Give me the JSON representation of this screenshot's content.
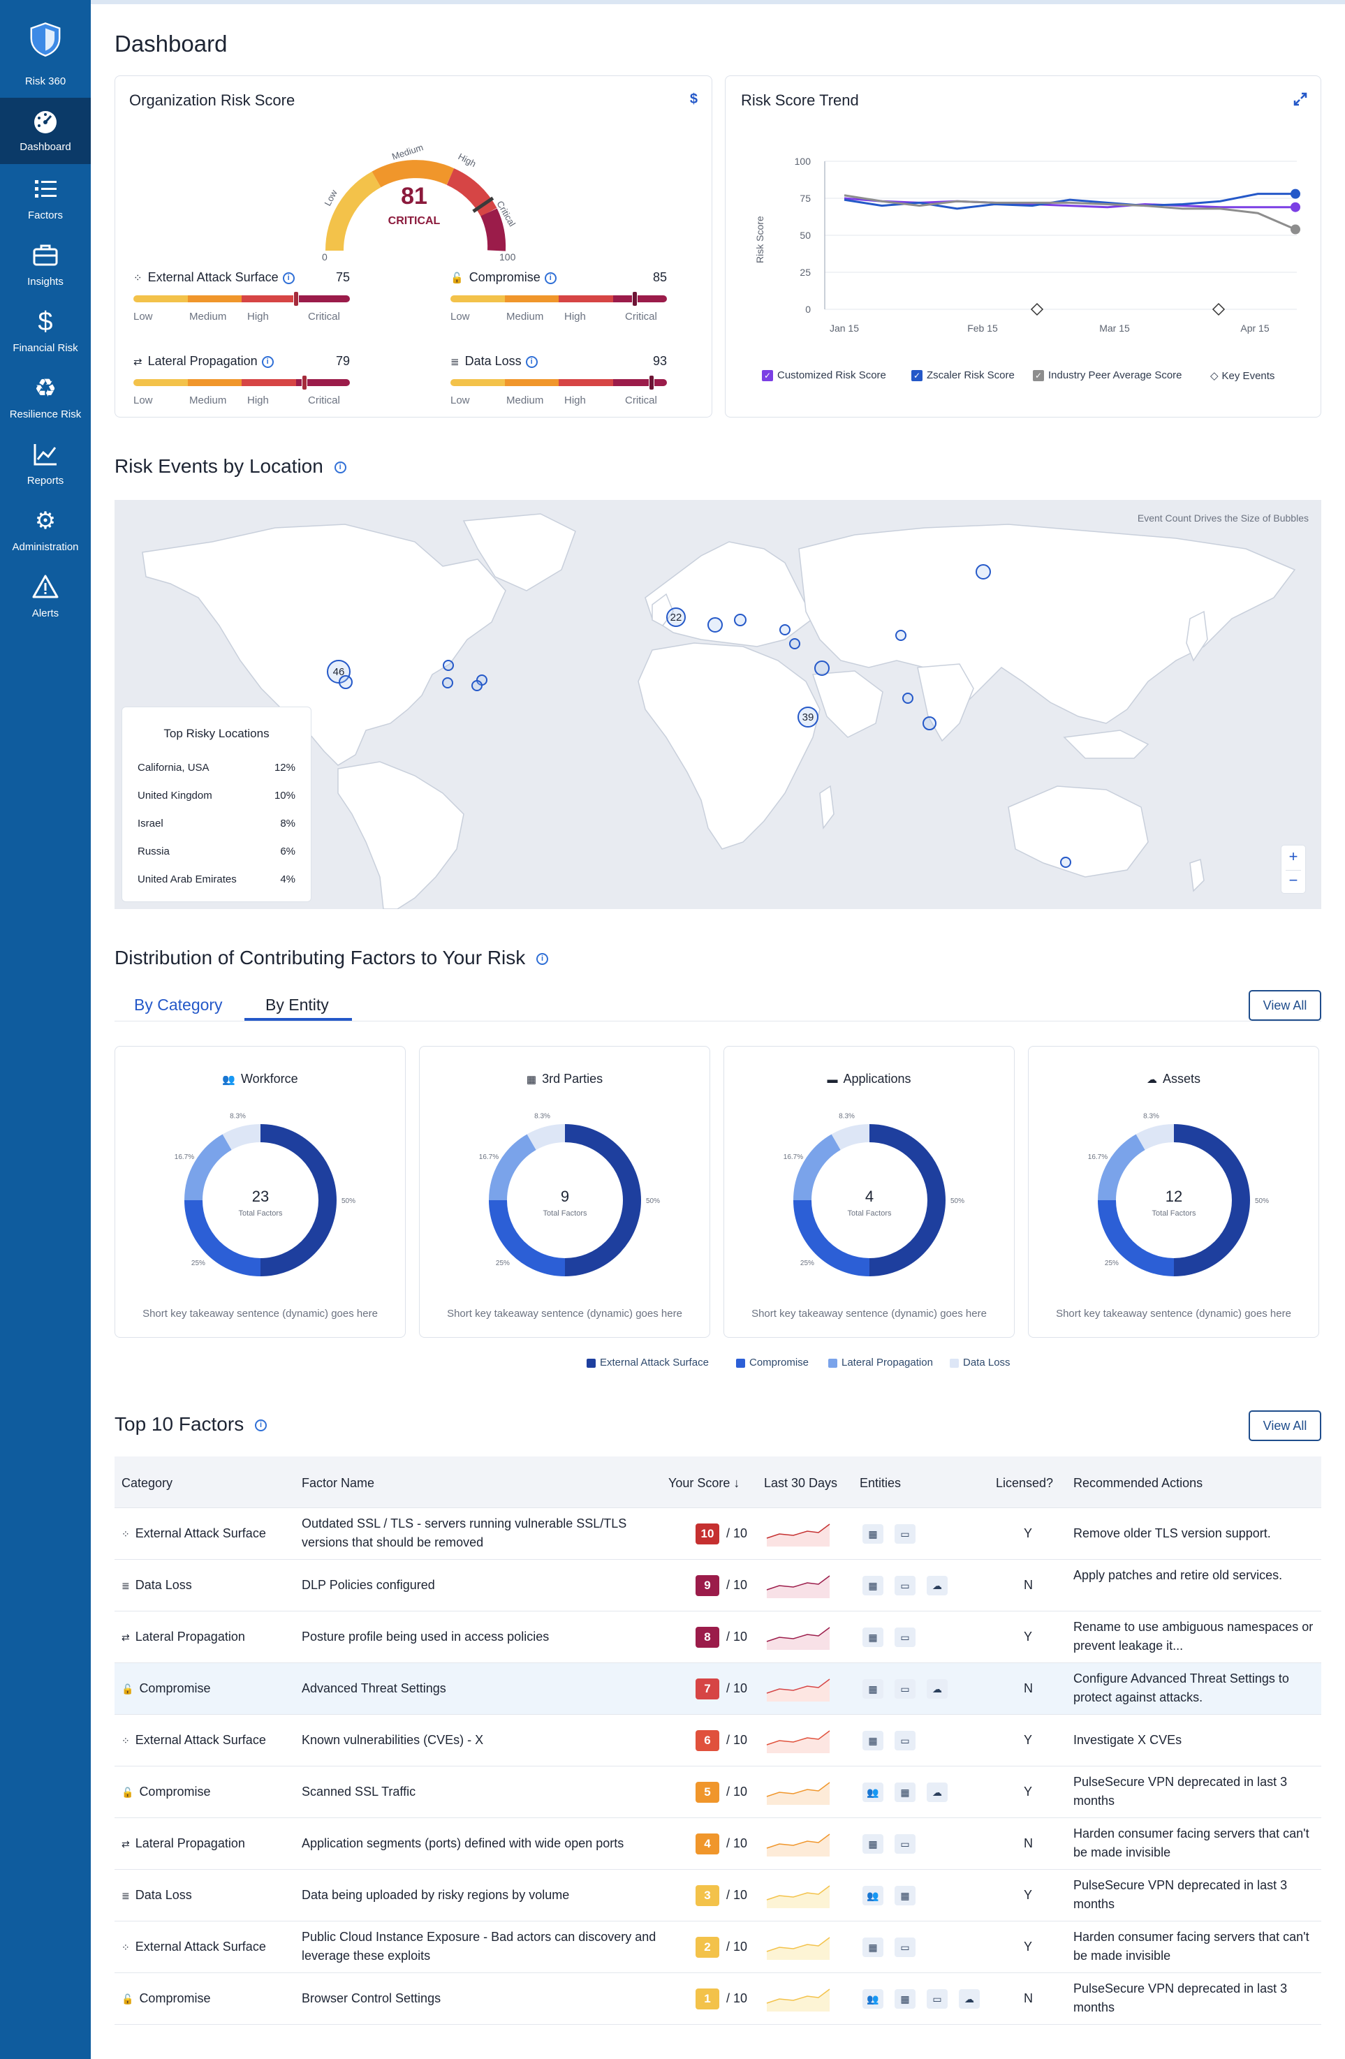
{
  "sidebar": {
    "logo_label": "Risk 360",
    "items": [
      {
        "label": "Dashboard",
        "icon": "gauge-icon"
      },
      {
        "label": "Factors",
        "icon": "list-icon"
      },
      {
        "label": "Insights",
        "icon": "briefcase-icon"
      },
      {
        "label": "Financial Risk",
        "icon": "dollar-icon"
      },
      {
        "label": "Resilience Risk",
        "icon": "recycle-icon"
      },
      {
        "label": "Reports",
        "icon": "chart-line-icon"
      },
      {
        "label": "Administration",
        "icon": "gears-icon"
      },
      {
        "label": "Alerts",
        "icon": "warning-icon"
      }
    ]
  },
  "page": {
    "title": "Dashboard"
  },
  "risk_score": {
    "title": "Organization Risk Score",
    "currency_symbol": "$",
    "score": "81",
    "level": "CRITICAL",
    "score_value": 81,
    "gauge_min": "0",
    "gauge_max": "100",
    "gauge_labels": {
      "low": "Low",
      "medium": "Medium",
      "high": "High",
      "critical": "Critical"
    },
    "metrics": [
      {
        "name": "External Attack Surface",
        "value": "75",
        "score": 75,
        "icon": "network-icon"
      },
      {
        "name": "Compromise",
        "value": "85",
        "score": 85,
        "icon": "unlock-icon"
      },
      {
        "name": "Lateral Propagation",
        "value": "79",
        "score": 79,
        "icon": "arrows-icon"
      },
      {
        "name": "Data Loss",
        "value": "93",
        "score": 93,
        "icon": "database-icon"
      }
    ],
    "scale_labels": [
      "Low",
      "Medium",
      "High",
      "Critical"
    ]
  },
  "trend": {
    "title": "Risk Score Trend",
    "chart_data": {
      "type": "line",
      "ylabel": "Risk Score",
      "ylim": [
        0,
        100
      ],
      "yticks": [
        "100",
        "75",
        "50",
        "25",
        "0"
      ],
      "xticks": [
        "Jan 15",
        "Feb 15",
        "Mar 15",
        "Apr 15"
      ],
      "series": [
        {
          "name": "Customized Risk Score",
          "color": "#7b3fe4",
          "values": [
            75,
            73,
            72,
            73,
            72,
            71,
            70,
            69,
            71,
            70,
            69,
            69,
            69
          ]
        },
        {
          "name": "Zscaler Risk Score",
          "color": "#2458c8",
          "values": [
            74,
            70,
            72,
            68,
            71,
            70,
            74,
            72,
            70,
            71,
            73,
            78,
            78
          ]
        },
        {
          "name": "Industry Peer Average Score",
          "color": "#8d8d8d",
          "values": [
            77,
            73,
            70,
            73,
            72,
            72,
            72,
            71,
            70,
            68,
            68,
            65,
            54
          ]
        }
      ],
      "key_events": [
        "Feb 25",
        "Apr 10"
      ],
      "legend": [
        "Customized Risk Score",
        "Zscaler Risk Score",
        "Industry Peer Average Score",
        "Key Events"
      ]
    }
  },
  "map": {
    "title": "Risk Events by Location",
    "note": "Event Count Drives the Size of Bubbles",
    "bubble_labels": [
      "22",
      "46",
      "39"
    ],
    "top_locations_title": "Top Risky Locations",
    "top_locations": [
      {
        "name": "California, USA",
        "pct": "12%"
      },
      {
        "name": "United Kingdom",
        "pct": "10%"
      },
      {
        "name": "Israel",
        "pct": "8%"
      },
      {
        "name": "Russia",
        "pct": "6%"
      },
      {
        "name": "United Arab Emirates",
        "pct": "4%"
      }
    ],
    "zoom_in": "+",
    "zoom_out": "−"
  },
  "distribution": {
    "title": "Distribution of Contributing Factors to Your Risk",
    "tabs": [
      "By Category",
      "By Entity"
    ],
    "active_tab": "By Entity",
    "view_all": "View All",
    "cards": [
      {
        "title": "Workforce",
        "icon": "users-icon",
        "total": "23",
        "total_label": "Total Factors",
        "footer": "Short key takeaway sentence (dynamic) goes here"
      },
      {
        "title": "3rd Parties",
        "icon": "grid-icon",
        "total": "9",
        "total_label": "Total Factors",
        "footer": "Short key takeaway sentence (dynamic) goes here"
      },
      {
        "title": "Applications",
        "icon": "window-icon",
        "total": "4",
        "total_label": "Total Factors",
        "footer": "Short key takeaway sentence (dynamic) goes here"
      },
      {
        "title": "Assets",
        "icon": "cloud-icon",
        "total": "12",
        "total_label": "Total Factors",
        "footer": "Short key takeaway sentence (dynamic) goes here"
      }
    ],
    "chart_data": {
      "type": "pie",
      "categories": [
        "External Attack Surface",
        "Compromise",
        "Lateral Propagation",
        "Data Loss"
      ],
      "values": [
        50,
        25,
        16.7,
        8.3
      ],
      "labels": [
        "50%",
        "25%",
        "16.7%",
        "8.3%"
      ],
      "colors": [
        "#1e3f9e",
        "#2c5fd6",
        "#7aa3ea",
        "#dde6f6"
      ]
    },
    "legend": [
      "External Attack Surface",
      "Compromise",
      "Lateral Propagation",
      "Data Loss"
    ]
  },
  "factors": {
    "title": "Top 10 Factors",
    "view_all": "View All",
    "headers": [
      "Category",
      "Factor Name",
      "Your Score",
      "Last 30 Days",
      "Entities",
      "Licensed?",
      "Recommended Actions"
    ],
    "sort_arrow": "↓",
    "out_of": "/ 10",
    "rows": [
      {
        "category": "External Attack Surface",
        "cat_icon": "network-icon",
        "name": "Outdated SSL / TLS - servers running vulnerable SSL/TLS versions that should be removed",
        "score": "10",
        "color": "#c53030",
        "entities": [
          "grid-icon",
          "window-icon"
        ],
        "licensed": "Y",
        "action": "Remove older TLS version support."
      },
      {
        "category": "Data Loss",
        "cat_icon": "database-icon",
        "name": "DLP Policies configured",
        "score": "9",
        "color": "#9b1c4a",
        "entities": [
          "grid-icon",
          "window-icon",
          "cloud-icon"
        ],
        "licensed": "N",
        "action": "Apply patches and retire old services."
      },
      {
        "category": "Lateral Propagation",
        "cat_icon": "arrows-icon",
        "name": "Posture profile being used in access policies",
        "score": "8",
        "color": "#9b1c4a",
        "entities": [
          "grid-icon",
          "window-icon"
        ],
        "licensed": "Y",
        "action": "Rename to use ambiguous namespaces or prevent leakage it..."
      },
      {
        "category": "Compromise",
        "cat_icon": "unlock-icon",
        "name": "Advanced Threat Settings",
        "score": "7",
        "color": "#d64545",
        "entities": [
          "grid-icon",
          "window-icon",
          "cloud-icon"
        ],
        "licensed": "N",
        "action": "Configure Advanced Threat Settings to protect against attacks."
      },
      {
        "category": "External Attack Surface",
        "cat_icon": "network-icon",
        "name": "Known vulnerabilities (CVEs) - X",
        "score": "6",
        "color": "#e0513c",
        "entities": [
          "grid-icon",
          "window-icon"
        ],
        "licensed": "Y",
        "action": "Investigate X CVEs"
      },
      {
        "category": "Compromise",
        "cat_icon": "unlock-icon",
        "name": "Scanned SSL Traffic",
        "score": "5",
        "color": "#f0962b",
        "entities": [
          "users-icon",
          "grid-icon",
          "cloud-icon"
        ],
        "licensed": "Y",
        "action": "PulseSecure VPN deprecated in last 3 months"
      },
      {
        "category": "Lateral Propagation",
        "cat_icon": "arrows-icon",
        "name": "Application segments (ports) defined with wide open ports",
        "score": "4",
        "color": "#f0962b",
        "entities": [
          "grid-icon",
          "window-icon"
        ],
        "licensed": "N",
        "action": "Harden consumer facing servers that can't be made invisible"
      },
      {
        "category": "Data Loss",
        "cat_icon": "database-icon",
        "name": "Data being uploaded by risky regions by volume",
        "score": "3",
        "color": "#f3c24a",
        "entities": [
          "users-icon",
          "grid-icon"
        ],
        "licensed": "Y",
        "action": "PulseSecure VPN deprecated in last 3 months"
      },
      {
        "category": "External Attack Surface",
        "cat_icon": "network-icon",
        "name": "Public Cloud Instance Exposure - Bad actors can discovery and leverage these exploits",
        "score": "2",
        "color": "#f3c24a",
        "entities": [
          "grid-icon",
          "window-icon"
        ],
        "licensed": "Y",
        "action": "Harden consumer facing servers that can't be made invisible"
      },
      {
        "category": "Compromise",
        "cat_icon": "unlock-icon",
        "name": "Browser Control Settings",
        "score": "1",
        "color": "#f3c24a",
        "entities": [
          "users-icon",
          "grid-icon",
          "window-icon",
          "cloud-icon"
        ],
        "licensed": "N",
        "action": "PulseSecure VPN deprecated in last 3 months"
      }
    ]
  }
}
